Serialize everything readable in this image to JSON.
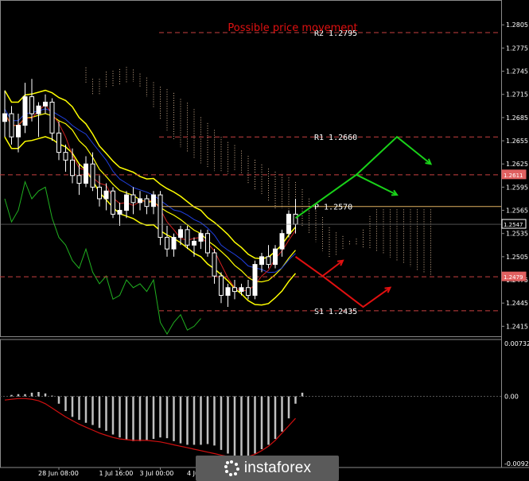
{
  "chart_data": [
    {
      "type": "line",
      "title": "Possible price movement",
      "price_axis": {
        "ticks": [
          "1.2805",
          "1.2775",
          "1.2745",
          "1.2715",
          "1.2685",
          "1.2655",
          "1.2625",
          "1.2595",
          "1.2565",
          "1.2535",
          "1.2505",
          "1.2475",
          "1.2445",
          "1.2415"
        ],
        "range": [
          1.2402,
          1.2832
        ],
        "current_price": "1.2547",
        "current_price_color": "#ffffff",
        "tags": [
          {
            "value": "1.2611",
            "color": "#e06060"
          },
          {
            "value": "1.2479",
            "color": "#e06060"
          }
        ]
      },
      "levels": [
        {
          "label": "R2 1.2795",
          "value": 1.2795,
          "color": "#c84040",
          "style": "dashed"
        },
        {
          "label": "R1 1.2660",
          "value": 1.266,
          "color": "#c84040",
          "style": "dashed"
        },
        {
          "label": "P 1.2570",
          "value": 1.257,
          "color": "#e0b060",
          "style": "solid"
        },
        {
          "label": "S1 1.2435",
          "value": 1.2435,
          "color": "#c84040",
          "style": "dashed"
        },
        {
          "label": "",
          "value": 1.2611,
          "color": "#c84040",
          "style": "dashed"
        },
        {
          "label": "",
          "value": 1.2479,
          "color": "#c84040",
          "style": "dashed"
        }
      ],
      "candles": [
        [
          1.268,
          1.272,
          1.266,
          1.269
        ],
        [
          1.269,
          1.27,
          1.265,
          1.266
        ],
        [
          1.266,
          1.269,
          1.264,
          1.2675
        ],
        [
          1.2675,
          1.273,
          1.2665,
          1.2712
        ],
        [
          1.2712,
          1.2735,
          1.268,
          1.269
        ],
        [
          1.269,
          1.2705,
          1.266,
          1.27
        ],
        [
          1.27,
          1.2715,
          1.269,
          1.2705
        ],
        [
          1.2705,
          1.271,
          1.2655,
          1.2665
        ],
        [
          1.2665,
          1.268,
          1.263,
          1.264
        ],
        [
          1.264,
          1.265,
          1.2615,
          1.263
        ],
        [
          1.263,
          1.2645,
          1.26,
          1.261
        ],
        [
          1.261,
          1.2625,
          1.2585,
          1.26
        ],
        [
          1.26,
          1.2635,
          1.2595,
          1.2625
        ],
        [
          1.2625,
          1.264,
          1.259,
          1.2595
        ],
        [
          1.2595,
          1.261,
          1.257,
          1.258
        ],
        [
          1.258,
          1.26,
          1.2565,
          1.259
        ],
        [
          1.259,
          1.2595,
          1.2555,
          1.256
        ],
        [
          1.256,
          1.2575,
          1.2545,
          1.2565
        ],
        [
          1.2565,
          1.259,
          1.2555,
          1.2585
        ],
        [
          1.2585,
          1.2595,
          1.256,
          1.2575
        ],
        [
          1.2575,
          1.259,
          1.2565,
          1.258
        ],
        [
          1.258,
          1.2585,
          1.256,
          1.257
        ],
        [
          1.257,
          1.259,
          1.256,
          1.2585
        ],
        [
          1.2585,
          1.259,
          1.252,
          1.253
        ],
        [
          1.253,
          1.2545,
          1.2505,
          1.2515
        ],
        [
          1.2515,
          1.2535,
          1.2505,
          1.253
        ],
        [
          1.253,
          1.2545,
          1.252,
          1.254
        ],
        [
          1.254,
          1.2545,
          1.2515,
          1.252
        ],
        [
          1.252,
          1.253,
          1.2505,
          1.2525
        ],
        [
          1.2525,
          1.254,
          1.2515,
          1.2535
        ],
        [
          1.2535,
          1.254,
          1.2505,
          1.251
        ],
        [
          1.251,
          1.2515,
          1.247,
          1.248
        ],
        [
          1.248,
          1.2485,
          1.2445,
          1.2455
        ],
        [
          1.2455,
          1.247,
          1.244,
          1.2465
        ],
        [
          1.2465,
          1.2475,
          1.245,
          1.246
        ],
        [
          1.246,
          1.247,
          1.2455,
          1.2465
        ],
        [
          1.2465,
          1.2475,
          1.245,
          1.2455
        ],
        [
          1.2455,
          1.25,
          1.245,
          1.2495
        ],
        [
          1.2495,
          1.251,
          1.2485,
          1.2505
        ],
        [
          1.2505,
          1.252,
          1.249,
          1.2495
        ],
        [
          1.2495,
          1.252,
          1.249,
          1.2515
        ],
        [
          1.2515,
          1.254,
          1.2505,
          1.2535
        ],
        [
          1.2535,
          1.2565,
          1.253,
          1.256
        ],
        [
          1.256,
          1.258,
          1.2535,
          1.2547
        ]
      ],
      "projections": [
        {
          "color": "#19d219",
          "points": [
            [
              43,
              1.2555
            ],
            [
              52,
              1.2611
            ],
            [
              58,
              1.2585
            ]
          ]
        },
        {
          "color": "#19d219",
          "points": [
            [
              52,
              1.2611
            ],
            [
              58,
              1.266
            ],
            [
              63,
              1.2625
            ]
          ]
        },
        {
          "color": "#e01010",
          "points": [
            [
              43,
              1.2505
            ],
            [
              47,
              1.248
            ],
            [
              50,
              1.25
            ]
          ]
        },
        {
          "color": "#e01010",
          "points": [
            [
              47,
              1.248
            ],
            [
              53,
              1.244
            ],
            [
              57,
              1.2465
            ]
          ]
        }
      ],
      "x_ticks": [
        "28 Jun 08:00",
        "1 Jul 16:00",
        "3 Jul 00:00",
        "4 Jul 08:00",
        "5 Jul"
      ],
      "colors": {
        "envelope": "#ffff00",
        "tenkan": "#d02020",
        "kijun": "#2040e0",
        "chikou": "#20b020",
        "cloud": "#d0b090"
      }
    },
    {
      "type": "bar",
      "axis": {
        "ticks": [
          "0.00732",
          "0.00",
          "-0.00926"
        ],
        "range": [
          -0.00926,
          0.00732
        ]
      },
      "values": [
        0.0,
        0.0002,
        0.0003,
        0.0003,
        0.0005,
        0.0006,
        0.0004,
        0.0001,
        -0.001,
        -0.002,
        -0.0028,
        -0.0032,
        -0.0036,
        -0.0039,
        -0.0043,
        -0.0047,
        -0.0052,
        -0.0056,
        -0.0059,
        -0.0061,
        -0.0061,
        -0.006,
        -0.0058,
        -0.0056,
        -0.0057,
        -0.0061,
        -0.0064,
        -0.0066,
        -0.0066,
        -0.0066,
        -0.0065,
        -0.0067,
        -0.0073,
        -0.0078,
        -0.0082,
        -0.0083,
        -0.0083,
        -0.0078,
        -0.0072,
        -0.0066,
        -0.0058,
        -0.0048,
        -0.003,
        -0.001,
        0.0005
      ],
      "signal": [
        -0.0005,
        -0.0004,
        -0.0003,
        -0.0003,
        -0.0004,
        -0.0006,
        -0.001,
        -0.0016,
        -0.0022,
        -0.0028,
        -0.0033,
        -0.0038,
        -0.0042,
        -0.0046,
        -0.005,
        -0.0053,
        -0.0056,
        -0.0058,
        -0.0059,
        -0.006,
        -0.006,
        -0.006,
        -0.0061,
        -0.0062,
        -0.0064,
        -0.0066,
        -0.0068,
        -0.007,
        -0.0072,
        -0.0074,
        -0.0076,
        -0.0078,
        -0.008,
        -0.0082,
        -0.0083,
        -0.0083,
        -0.0082,
        -0.0079,
        -0.0074,
        -0.0068,
        -0.006,
        -0.005,
        -0.004,
        -0.003
      ],
      "colors": {
        "bars": "#c0c0c0",
        "signal": "#d01010"
      }
    }
  ],
  "brand": {
    "name": "instaforex"
  }
}
